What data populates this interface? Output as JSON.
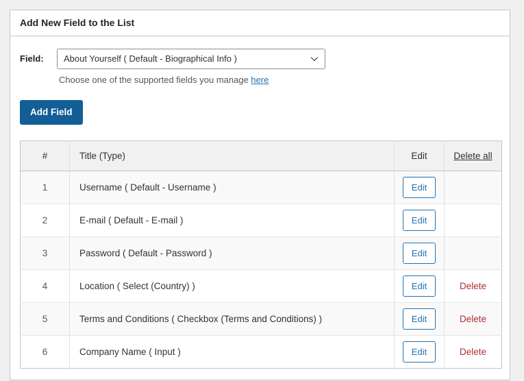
{
  "panel": {
    "title": "Add New Field to the List"
  },
  "form": {
    "field_label": "Field:",
    "select": {
      "selected": "About Yourself ( Default - Biographical Info )",
      "chevron_icon": "chevron-down-icon"
    },
    "help_prefix": "Choose one of the supported fields you manage ",
    "help_link": "here",
    "add_button": "Add Field"
  },
  "table": {
    "headers": {
      "num": "#",
      "title": "Title (Type)",
      "edit": "Edit",
      "delete_all": "Delete all"
    },
    "edit_label": "Edit",
    "delete_label": "Delete",
    "rows": [
      {
        "num": "1",
        "title": "Username ( Default - Username )",
        "edit": "Edit",
        "delete": ""
      },
      {
        "num": "2",
        "title": "E-mail ( Default - E-mail )",
        "edit": "Edit",
        "delete": ""
      },
      {
        "num": "3",
        "title": "Password ( Default - Password )",
        "edit": "Edit",
        "delete": ""
      },
      {
        "num": "4",
        "title": "Location ( Select (Country) )",
        "edit": "Edit",
        "delete": "Delete"
      },
      {
        "num": "5",
        "title": "Terms and Conditions ( Checkbox (Terms and Conditions) )",
        "edit": "Edit",
        "delete": "Delete"
      },
      {
        "num": "6",
        "title": "Company Name ( Input )",
        "edit": "Edit",
        "delete": "Delete"
      }
    ]
  },
  "colors": {
    "page_background": "#f0f0f1",
    "panel_border": "#c3c4c7",
    "primary_button": "#135e96",
    "link": "#2271b1",
    "danger": "#b32d2e",
    "header_row": "#f1f1f1",
    "stripe_row": "#f9f9f9"
  }
}
